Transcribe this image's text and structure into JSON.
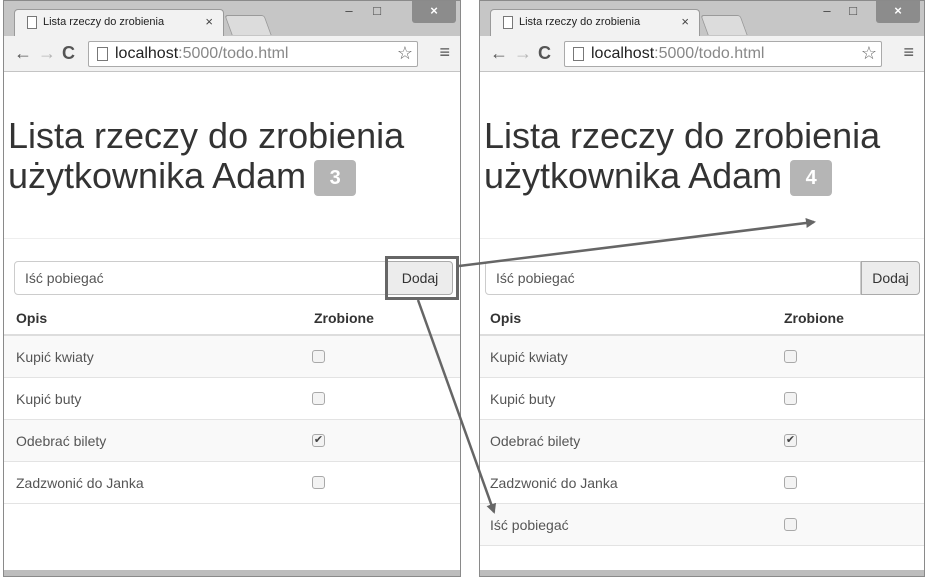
{
  "left": {
    "tab_title": "Lista rzeczy do zrobienia",
    "url_host": "localhost",
    "url_path": ":5000/todo.html",
    "heading_line1": "Lista rzeczy do zrobienia",
    "heading_line2": "użytkownika Adam",
    "badge_count": "3",
    "input_value": "Iść pobiegać",
    "add_label": "Dodaj",
    "col_desc": "Opis",
    "col_done": "Zrobione",
    "items": [
      {
        "desc": "Kupić kwiaty",
        "done": false
      },
      {
        "desc": "Kupić buty",
        "done": false
      },
      {
        "desc": "Odebrać bilety",
        "done": true
      },
      {
        "desc": "Zadzwonić do Janka",
        "done": false
      }
    ]
  },
  "right": {
    "tab_title": "Lista rzeczy do zrobienia",
    "url_host": "localhost",
    "url_path": ":5000/todo.html",
    "heading_line1": "Lista rzeczy do zrobienia",
    "heading_line2": "użytkownika Adam",
    "badge_count": "4",
    "input_value": "Iść pobiegać",
    "add_label": "Dodaj",
    "col_desc": "Opis",
    "col_done": "Zrobione",
    "items": [
      {
        "desc": "Kupić kwiaty",
        "done": false
      },
      {
        "desc": "Kupić buty",
        "done": false
      },
      {
        "desc": "Odebrać bilety",
        "done": true
      },
      {
        "desc": "Zadzwonić do Janka",
        "done": false
      },
      {
        "desc": "Iść pobiegać",
        "done": false
      }
    ]
  },
  "icons": {
    "back": "←",
    "forward": "→",
    "reload": "C",
    "star": "☆",
    "menu": "≡",
    "minimize": "–",
    "maximize": "□",
    "close": "×",
    "check": "✔"
  },
  "colors": {
    "badge": "#b5b5b5",
    "annotation": "#666666"
  }
}
